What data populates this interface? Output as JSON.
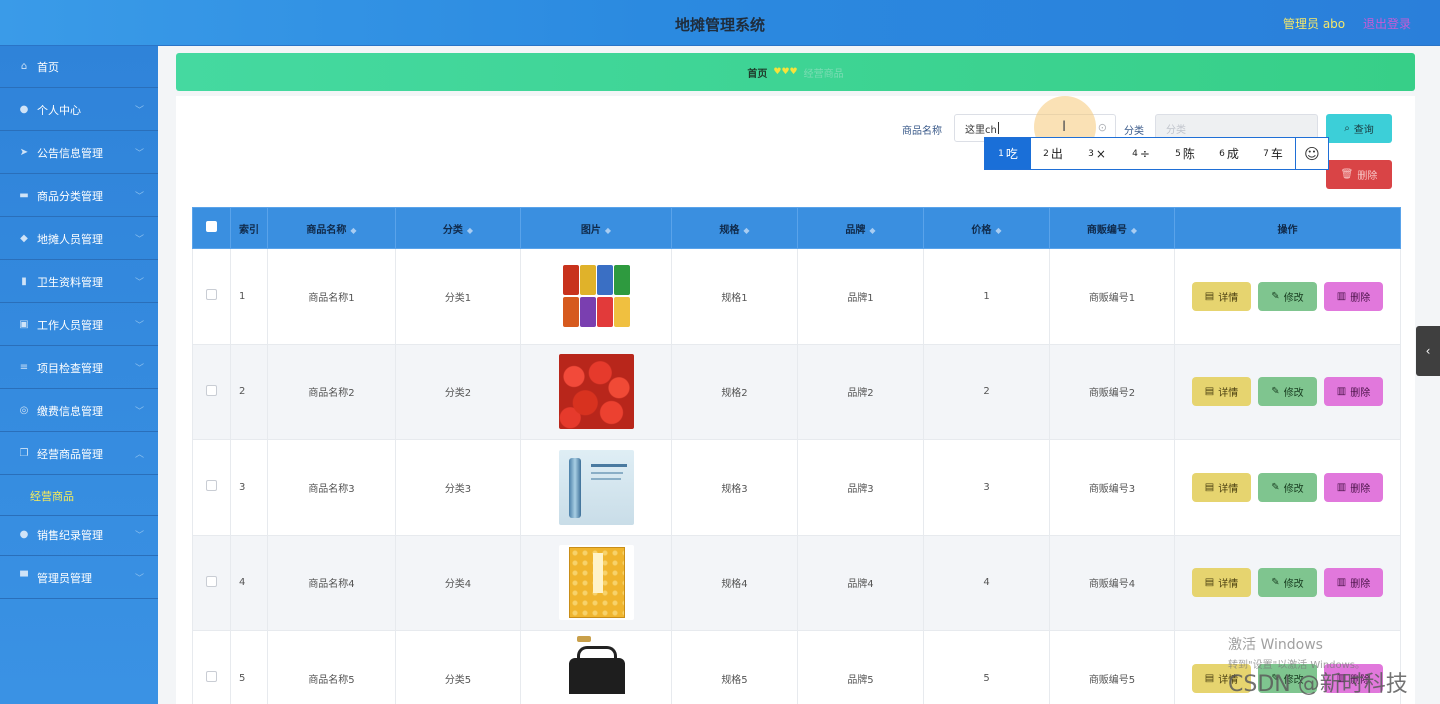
{
  "header": {
    "title": "地摊管理系统",
    "admin_text": "管理员 abo",
    "logout": "退出登录"
  },
  "sidebar": {
    "items": [
      {
        "label": "首页",
        "icon": "home-icon",
        "glyph": "⌂",
        "arrow": false
      },
      {
        "label": "个人中心",
        "icon": "user-icon",
        "glyph": "●",
        "arrow": true
      },
      {
        "label": "公告信息管理",
        "icon": "send-icon",
        "glyph": "➤",
        "arrow": true
      },
      {
        "label": "商品分类管理",
        "icon": "list-icon",
        "glyph": "▬",
        "arrow": true
      },
      {
        "label": "地摊人员管理",
        "icon": "location-icon",
        "glyph": "◆",
        "arrow": true
      },
      {
        "label": "卫生资料管理",
        "icon": "chart-icon",
        "glyph": "▮",
        "arrow": true
      },
      {
        "label": "工作人员管理",
        "icon": "clipboard-icon",
        "glyph": "▣",
        "arrow": true
      },
      {
        "label": "项目检查管理",
        "icon": "menu-icon",
        "glyph": "≡",
        "arrow": true
      },
      {
        "label": "缴费信息管理",
        "icon": "globe-icon",
        "glyph": "◎",
        "arrow": true
      },
      {
        "label": "经营商品管理",
        "icon": "copy-icon",
        "glyph": "❐",
        "arrow": true,
        "expanded": true
      },
      {
        "label": "销售纪录管理",
        "icon": "user-icon",
        "glyph": "●",
        "arrow": true
      },
      {
        "label": "管理员管理",
        "icon": "briefcase-icon",
        "glyph": "▀",
        "arrow": true
      }
    ],
    "submenu": {
      "label": "经营商品"
    }
  },
  "breadcrumb": {
    "home": "首页",
    "separator": "♥♥♥",
    "current": "经营商品"
  },
  "search": {
    "name_label": "商品名称",
    "name_value": "这里ch",
    "category_label": "分类",
    "category_placeholder": "分类",
    "query_button": "查询",
    "delete_button": "删除"
  },
  "ime": {
    "candidates": [
      {
        "num": "1",
        "text": "吃",
        "selected": true
      },
      {
        "num": "2",
        "text": "出"
      },
      {
        "num": "3",
        "text": "×"
      },
      {
        "num": "4",
        "text": "÷"
      },
      {
        "num": "5",
        "text": "陈"
      },
      {
        "num": "6",
        "text": "成"
      },
      {
        "num": "7",
        "text": "车"
      }
    ],
    "emoji": "☺"
  },
  "table": {
    "columns": [
      "索引",
      "商品名称",
      "分类",
      "图片",
      "规格",
      "品牌",
      "价格",
      "商贩编号",
      "操作"
    ],
    "rows": [
      {
        "index": "1",
        "name": "商品名称1",
        "category": "分类1",
        "spec": "规格1",
        "brand": "品牌1",
        "price": "1",
        "vendor": "商贩编号1",
        "image": "snacks"
      },
      {
        "index": "2",
        "name": "商品名称2",
        "category": "分类2",
        "spec": "规格2",
        "brand": "品牌2",
        "price": "2",
        "vendor": "商贩编号2",
        "image": "cherries"
      },
      {
        "index": "3",
        "name": "商品名称3",
        "category": "分类3",
        "spec": "规格3",
        "brand": "品牌3",
        "price": "3",
        "vendor": "商贩编号3",
        "image": "skincare"
      },
      {
        "index": "4",
        "name": "商品名称4",
        "category": "分类4",
        "spec": "规格4",
        "brand": "品牌4",
        "price": "4",
        "vendor": "商贩编号4",
        "image": "book"
      },
      {
        "index": "5",
        "name": "商品名称5",
        "category": "分类5",
        "spec": "规格5",
        "brand": "品牌5",
        "price": "5",
        "vendor": "商贩编号5",
        "image": "bag"
      }
    ],
    "actions": {
      "detail": "详情",
      "edit": "修改",
      "delete": "删除"
    }
  },
  "overlay": {
    "watermark_line1": "激活 Windows",
    "watermark_line2": "转到\"设置\"以激活 Windows。",
    "csdn": "CSDN @新时科技"
  }
}
